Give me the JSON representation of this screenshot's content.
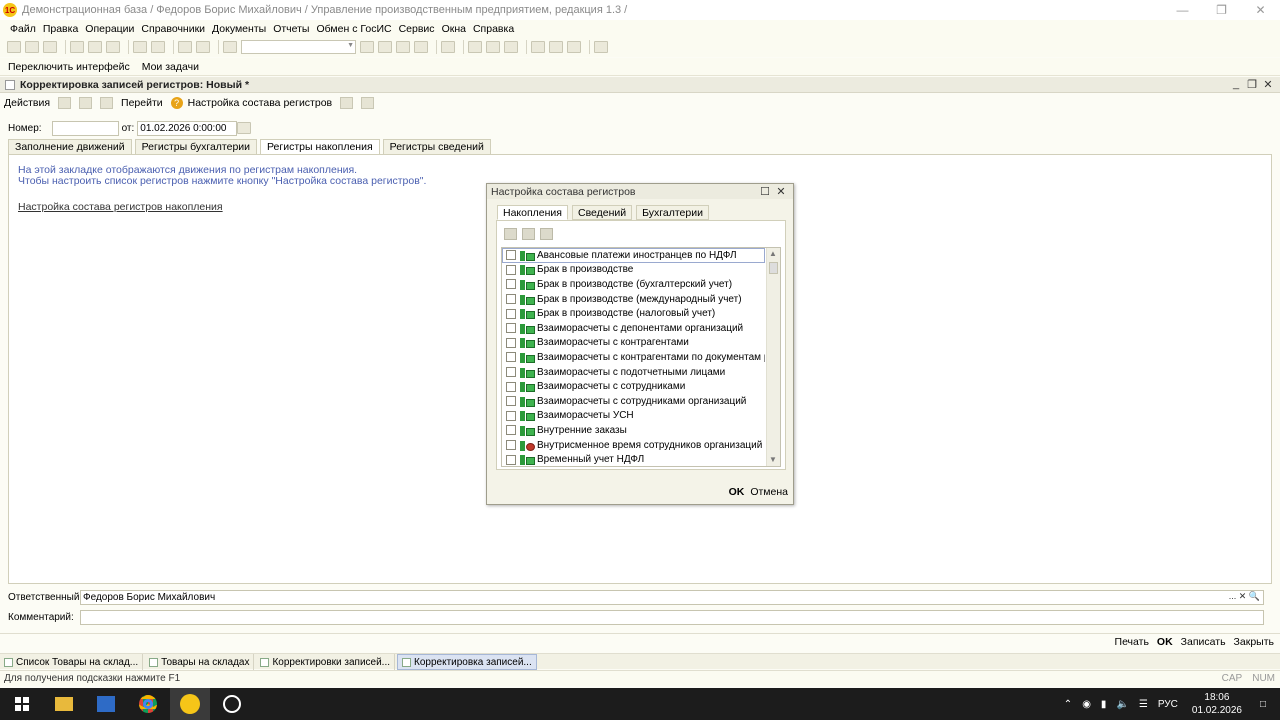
{
  "window": {
    "title": "Демонстрационная база / Федоров Борис Михайлович /  Управление производственным предприятием, редакция 1.3 /",
    "app_icon_text": "1С"
  },
  "menu": [
    "Файл",
    "Правка",
    "Операции",
    "Справочники",
    "Документы",
    "Отчеты",
    "Обмен с ГосИС",
    "Сервис",
    "Окна",
    "Справка"
  ],
  "panel": {
    "switch_interface": "Переключить интерфейс",
    "my_tasks": "Мои задачи"
  },
  "document": {
    "title": "Корректировка записей регистров: Новый *",
    "actions": "Действия",
    "goto": "Перейти",
    "help_icon": "?",
    "register_setup": "Настройка состава регистров",
    "number_label": "Номер:",
    "number_value": "",
    "from_label": "от:",
    "date_value": "01.02.2026  0:00:00",
    "tabs": [
      "Заполнение движений",
      "Регистры бухгалтерии",
      "Регистры накопления",
      "Регистры сведений"
    ],
    "info_line1": "На этой закладке отображаются движения по регистрам накопления.",
    "info_line2": "Чтобы настроить список регистров нажмите кнопку \"Настройка состава регистров\".",
    "link": "Настройка состава регистров накопления",
    "responsible_label": "Ответственный:",
    "responsible_value": "Федоров Борис Михайлович",
    "comment_label": "Комментарий:",
    "comment_value": "",
    "footer": {
      "print": "Печать",
      "ok": "OK",
      "save": "Записать",
      "close": "Закрыть"
    }
  },
  "dialog": {
    "title": "Настройка состава регистров",
    "tabs": [
      "Накопления",
      "Сведений",
      "Бухгалтерии"
    ],
    "registers": [
      "Авансовые платежи иностранцев по НДФЛ",
      "Брак в производстве",
      "Брак в производстве (бухгалтерский учет)",
      "Брак в производстве (международный учет)",
      "Брак в производстве (налоговый учет)",
      "Взаиморасчеты с депонентами организаций",
      "Взаиморасчеты с контрагентами",
      "Взаиморасчеты с контрагентами по документам ра...",
      "Взаиморасчеты с подотчетными лицами",
      "Взаиморасчеты с сотрудниками",
      "Взаиморасчеты с сотрудниками организаций",
      "Взаиморасчеты УСН",
      "Внутренние заказы",
      "Внутрисменное время сотрудников организаций",
      "Временный учет НДФЛ"
    ],
    "ok": "OK",
    "cancel": "Отмена"
  },
  "open_windows": [
    "Список Товары на склад...",
    "Товары на складах",
    "Корректировки записей...",
    "Корректировка записей..."
  ],
  "status": {
    "hint": "Для получения подсказки нажмите F1",
    "caps": "CAP",
    "num": "NUM"
  },
  "taskbar": {
    "lang": "РУС",
    "time": "18:06",
    "date": "01.02.2026",
    "apps": [
      "windows-start",
      "file-explorer",
      "outlook",
      "chrome",
      "1c",
      "clock-app"
    ]
  }
}
